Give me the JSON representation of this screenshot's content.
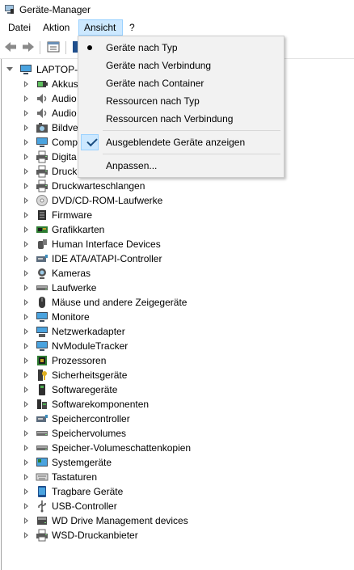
{
  "window": {
    "title": "Geräte-Manager"
  },
  "menubar": {
    "items": [
      "Datei",
      "Aktion",
      "Ansicht",
      "?"
    ]
  },
  "view_menu": {
    "items": [
      {
        "label": "Geräte nach Typ",
        "mark": "bullet"
      },
      {
        "label": "Geräte nach Verbindung",
        "mark": ""
      },
      {
        "label": "Geräte nach Container",
        "mark": ""
      },
      {
        "label": "Ressourcen nach Typ",
        "mark": ""
      },
      {
        "label": "Ressourcen nach Verbindung",
        "mark": ""
      },
      {
        "label": "Ausgeblendete Geräte anzeigen",
        "mark": "check"
      },
      {
        "label": "Anpassen...",
        "mark": ""
      }
    ]
  },
  "tree": {
    "root": "LAPTOP-C",
    "categories": [
      {
        "label": "Akkus",
        "icon": "battery-icon"
      },
      {
        "label": "Audio",
        "icon": "audio-icon"
      },
      {
        "label": "Audio",
        "icon": "audio-icon"
      },
      {
        "label": "Bildve",
        "icon": "camera-icon"
      },
      {
        "label": "Comp",
        "icon": "computer-icon"
      },
      {
        "label": "Digita",
        "icon": "digital-media-icon"
      },
      {
        "label": "Druck",
        "icon": "printer-icon"
      },
      {
        "label": "Druckwarteschlangen",
        "icon": "printer-icon"
      },
      {
        "label": "DVD/CD-ROM-Laufwerke",
        "icon": "disc-icon"
      },
      {
        "label": "Firmware",
        "icon": "firmware-icon"
      },
      {
        "label": "Grafikkarten",
        "icon": "display-adapter-icon"
      },
      {
        "label": "Human Interface Devices",
        "icon": "hid-icon"
      },
      {
        "label": "IDE ATA/ATAPI-Controller",
        "icon": "ide-controller-icon"
      },
      {
        "label": "Kameras",
        "icon": "webcam-icon"
      },
      {
        "label": "Laufwerke",
        "icon": "drive-icon"
      },
      {
        "label": "Mäuse und andere Zeigegeräte",
        "icon": "mouse-icon"
      },
      {
        "label": "Monitore",
        "icon": "monitor-icon"
      },
      {
        "label": "Netzwerkadapter",
        "icon": "network-adapter-icon"
      },
      {
        "label": "NvModuleTracker",
        "icon": "monitor-icon"
      },
      {
        "label": "Prozessoren",
        "icon": "processor-icon"
      },
      {
        "label": "Sicherheitsgeräte",
        "icon": "security-key-icon"
      },
      {
        "label": "Softwaregeräte",
        "icon": "software-device-icon"
      },
      {
        "label": "Softwarekomponenten",
        "icon": "software-component-icon"
      },
      {
        "label": "Speichercontroller",
        "icon": "storage-controller-icon"
      },
      {
        "label": "Speichervolumes",
        "icon": "volume-icon"
      },
      {
        "label": "Speicher-Volumeschattenkopien",
        "icon": "volume-shadow-icon"
      },
      {
        "label": "Systemgeräte",
        "icon": "system-device-icon"
      },
      {
        "label": "Tastaturen",
        "icon": "keyboard-icon"
      },
      {
        "label": "Tragbare Geräte",
        "icon": "portable-device-icon"
      },
      {
        "label": "USB-Controller",
        "icon": "usb-icon"
      },
      {
        "label": "WD Drive Management devices",
        "icon": "wd-device-icon"
      },
      {
        "label": "WSD-Druckanbieter",
        "icon": "wsd-printer-icon"
      }
    ]
  },
  "colors": {
    "menu_highlight": "#cce8ff",
    "menu_highlight_border": "#99d1ff",
    "menu_bg": "#f2f2f2"
  }
}
